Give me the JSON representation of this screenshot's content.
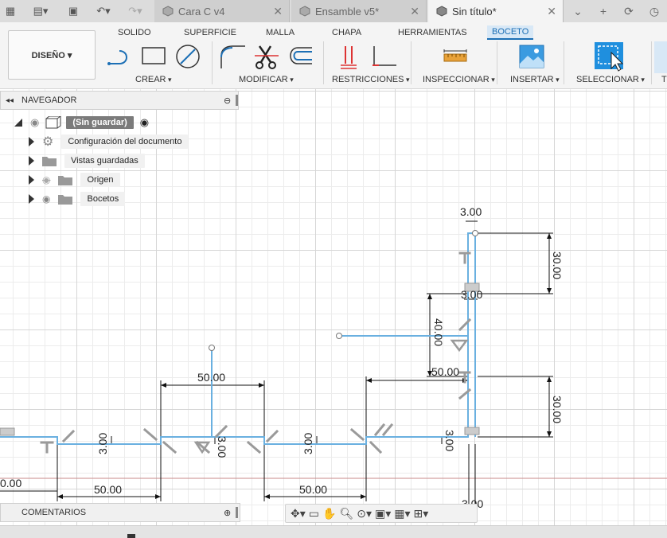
{
  "tabs": [
    {
      "label": "Cara C v4",
      "active": false
    },
    {
      "label": "Ensamble v5*",
      "active": false
    },
    {
      "label": "Sin título*",
      "active": true
    }
  ],
  "ribbon": {
    "tabs": [
      "SOLIDO",
      "SUPERFICIE",
      "MALLA",
      "CHAPA",
      "HERRAMIENTAS",
      "BOCETO"
    ],
    "active_tab": "BOCETO",
    "workspace": "DISEÑO ▾",
    "groups": [
      "CREAR",
      "MODIFICAR",
      "RESTRICCIONES",
      "INSPECCIONAR",
      "INSERTAR",
      "SELECCIONAR",
      "T"
    ]
  },
  "browser": {
    "title": "NAVEGADOR",
    "root": "(Sin guardar)",
    "items": [
      "Configuración del documento",
      "Vistas guardadas",
      "Origen",
      "Bocetos"
    ]
  },
  "comments": {
    "title": "COMENTARIOS"
  },
  "dimensions": {
    "top_width": "3.00",
    "right_height_upper": "30.00",
    "mid_width": "3.00",
    "left_height": "40.00",
    "horiz_mid": "50.00",
    "right_height_lower": "30.00",
    "center_top": "50.00",
    "v1": "3.00",
    "v2": "3.00",
    "v3": "3.00",
    "v4": "3.00",
    "bottom_left": "50.00",
    "bottom_right": "50.00",
    "far_left": "0.00",
    "bottom_v": "3.00"
  },
  "colors": {
    "sketch_line": "#6ab0e0",
    "accent": "#1c6fb5"
  }
}
